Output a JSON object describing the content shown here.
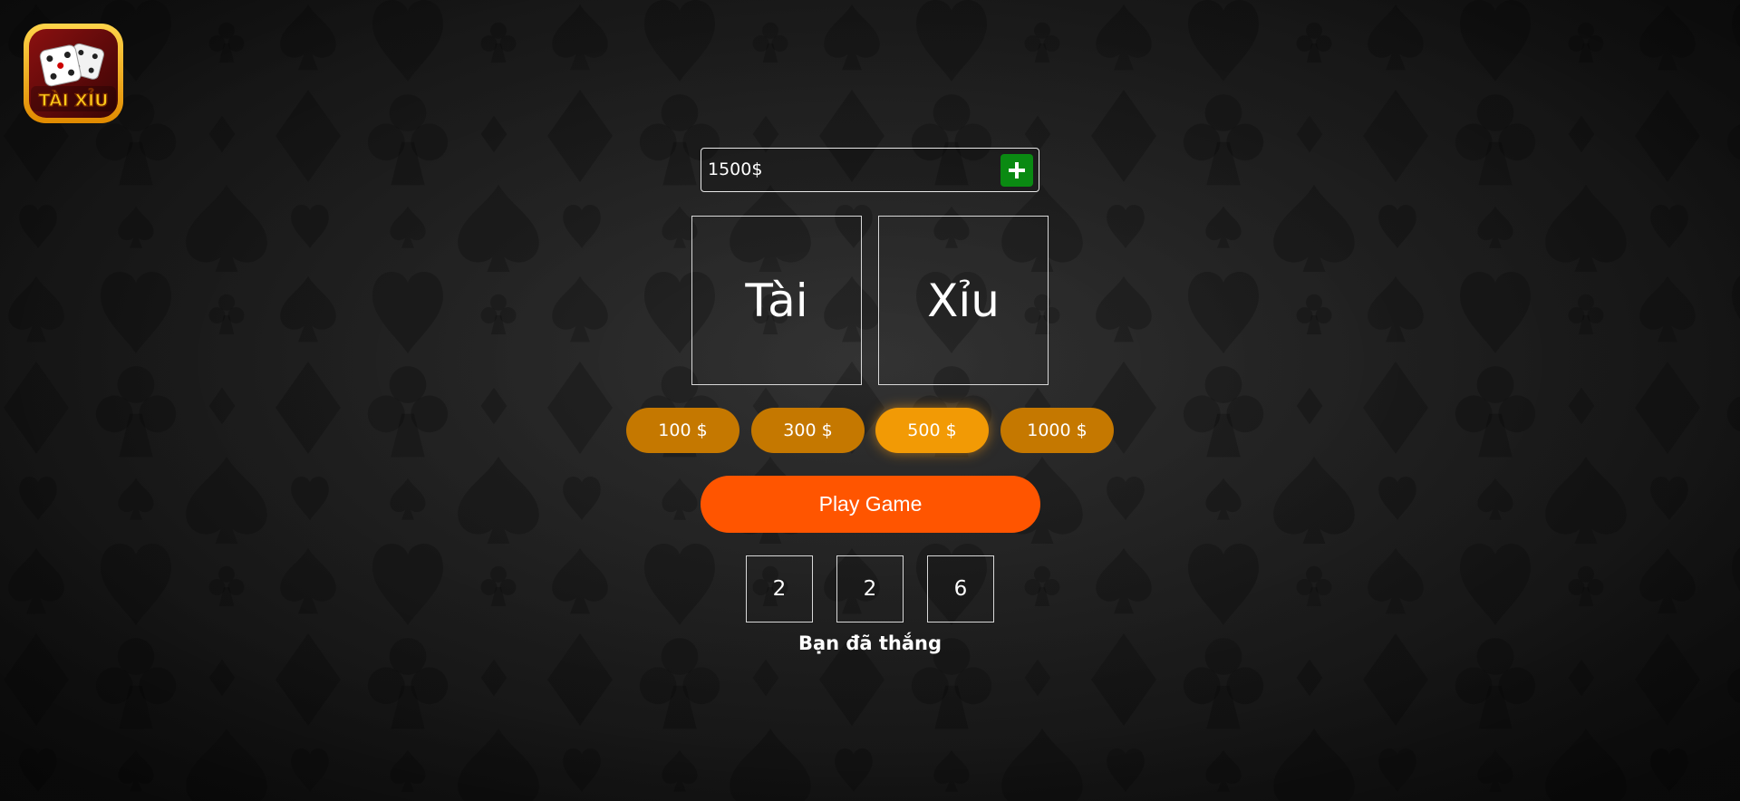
{
  "logo": {
    "text": "TÀI XỈU"
  },
  "balance": {
    "value": "1500$"
  },
  "bet_options": [
    {
      "label": "Tài"
    },
    {
      "label": "Xỉu"
    }
  ],
  "chips": [
    {
      "label": "100 $",
      "selected": false
    },
    {
      "label": "300 $",
      "selected": false
    },
    {
      "label": "500 $",
      "selected": true
    },
    {
      "label": "1000 $",
      "selected": false
    }
  ],
  "play_button": {
    "label": "Play Game"
  },
  "dice": [
    "2",
    "2",
    "6"
  ],
  "result": {
    "message": "Bạn đã thắng"
  },
  "colors": {
    "play_button": "#ff5500",
    "chip": "#c57800",
    "chip_selected": "#f29a05",
    "add_button": "#0a8a12"
  }
}
